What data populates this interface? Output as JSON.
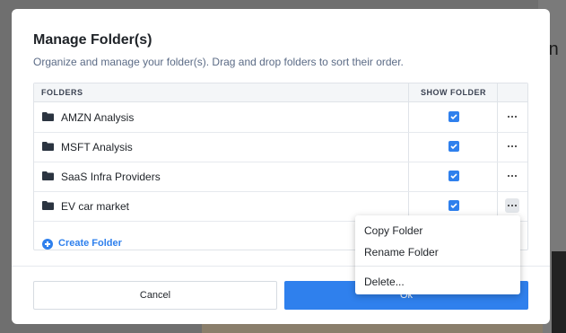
{
  "modal": {
    "title": "Manage Folder(s)",
    "subtitle": "Organize and manage your folder(s). Drag and drop folders to sort their order."
  },
  "table": {
    "headers": {
      "folders": "FOLDERS",
      "show_folder": "SHOW FOLDER"
    },
    "rows": [
      {
        "name": "AMZN Analysis",
        "show": true
      },
      {
        "name": "MSFT Analysis",
        "show": true
      },
      {
        "name": "SaaS Infra Providers",
        "show": true
      },
      {
        "name": "EV car market",
        "show": true
      }
    ],
    "create_label": "Create Folder"
  },
  "footer": {
    "cancel_label": "Cancel",
    "ok_label": "Ok"
  },
  "context_menu": {
    "items": [
      "Copy Folder",
      "Rename Folder",
      "Delete..."
    ]
  },
  "background": {
    "partial_text": "rn"
  },
  "colors": {
    "accent": "#2f80ed",
    "text": "#1f2328",
    "subtext": "#5b6b86"
  }
}
